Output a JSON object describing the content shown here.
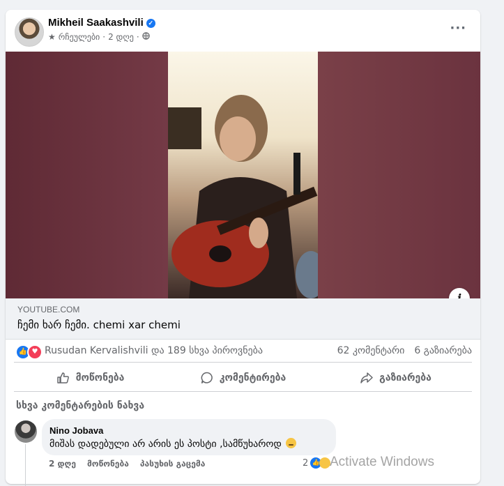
{
  "post": {
    "author": "Mikheil Saakashvili",
    "verified_icon": "verified-badge-icon",
    "meta_label": "რჩეულები",
    "time": "2 დღე",
    "separator": "·",
    "more_icon": "···"
  },
  "video": {
    "info_icon": "i"
  },
  "link": {
    "domain": "YOUTUBE.COM",
    "title": "ჩემი ხარ ჩემი. chemi xar chemi"
  },
  "stats": {
    "reactions_text": "Rusudan Kervalishvili და 189 სხვა პიროვნება",
    "comments": "62 კომენტარი",
    "shares": "6 გაზიარება"
  },
  "actions": {
    "like": "მოწონება",
    "comment": "კომენტირება",
    "share": "გაზიარება"
  },
  "comments": {
    "view_more": "სხვა კომენტარების ნახვა",
    "items": [
      {
        "author": "Nino Jobava",
        "text": "მიშას დადებული არ არის ეს პოსტი ,სამწუხაროდ",
        "time": "2 დღე",
        "like_label": "მოწონება",
        "reply_label": "პასუხის გაცემა",
        "reaction_count": "2"
      }
    ]
  },
  "watermark": "Activate Windows",
  "colors": {
    "accent": "#1877f2",
    "love": "#f33e58",
    "text_secondary": "#65676b",
    "background": "#f0f2f5"
  }
}
